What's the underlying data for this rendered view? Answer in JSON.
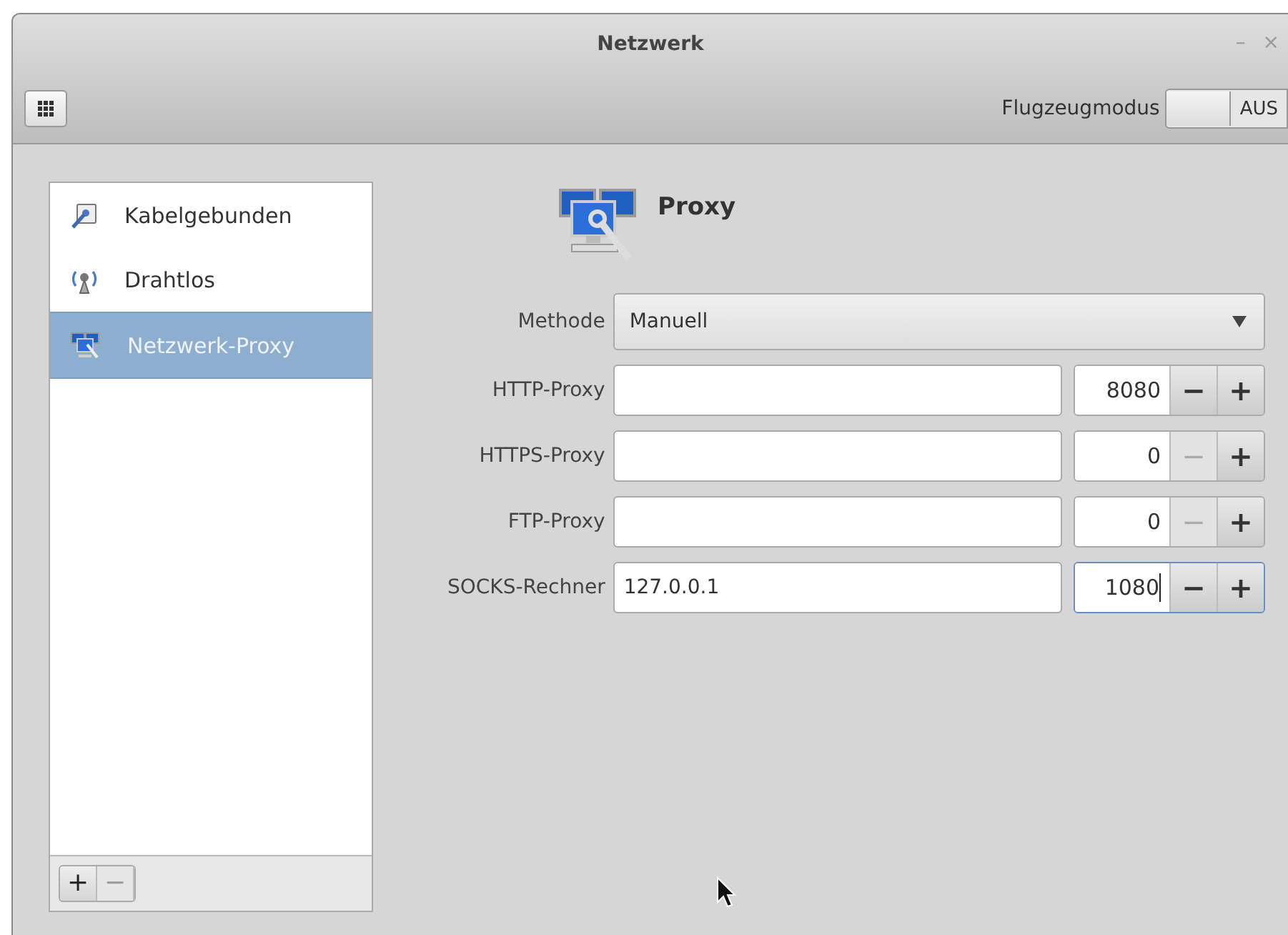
{
  "window": {
    "title": "Netzwerk",
    "controls": [
      "–",
      "×"
    ]
  },
  "toolbar": {
    "airplane_label": "Flugzeugmodus",
    "airplane_state": "AUS",
    "airplane_on": false
  },
  "sidebar": {
    "items": [
      {
        "label": "Kabelgebunden",
        "kind": "wired",
        "selected": false
      },
      {
        "label": "Drahtlos",
        "kind": "wireless",
        "selected": false
      },
      {
        "label": "Netzwerk-Proxy",
        "kind": "proxy",
        "selected": true
      }
    ],
    "buttons": [
      {
        "label": "+",
        "disabled": false
      },
      {
        "label": "−",
        "disabled": true
      }
    ]
  },
  "panel": {
    "title": "Proxy",
    "method": {
      "label": "Methode",
      "value": "Manuell"
    },
    "rows": [
      {
        "label": "HTTP-Proxy",
        "host": "",
        "port": "8080",
        "minus_disabled": false,
        "focused": false
      },
      {
        "label": "HTTPS-Proxy",
        "host": "",
        "port": "0",
        "minus_disabled": true,
        "focused": false
      },
      {
        "label": "FTP-Proxy",
        "host": "",
        "port": "0",
        "minus_disabled": true,
        "focused": false
      },
      {
        "label": "SOCKS-Rechner",
        "host": "127.0.0.1",
        "port": "1080",
        "minus_disabled": false,
        "focused": true
      }
    ],
    "spin_labels": [
      "−",
      "+"
    ]
  }
}
